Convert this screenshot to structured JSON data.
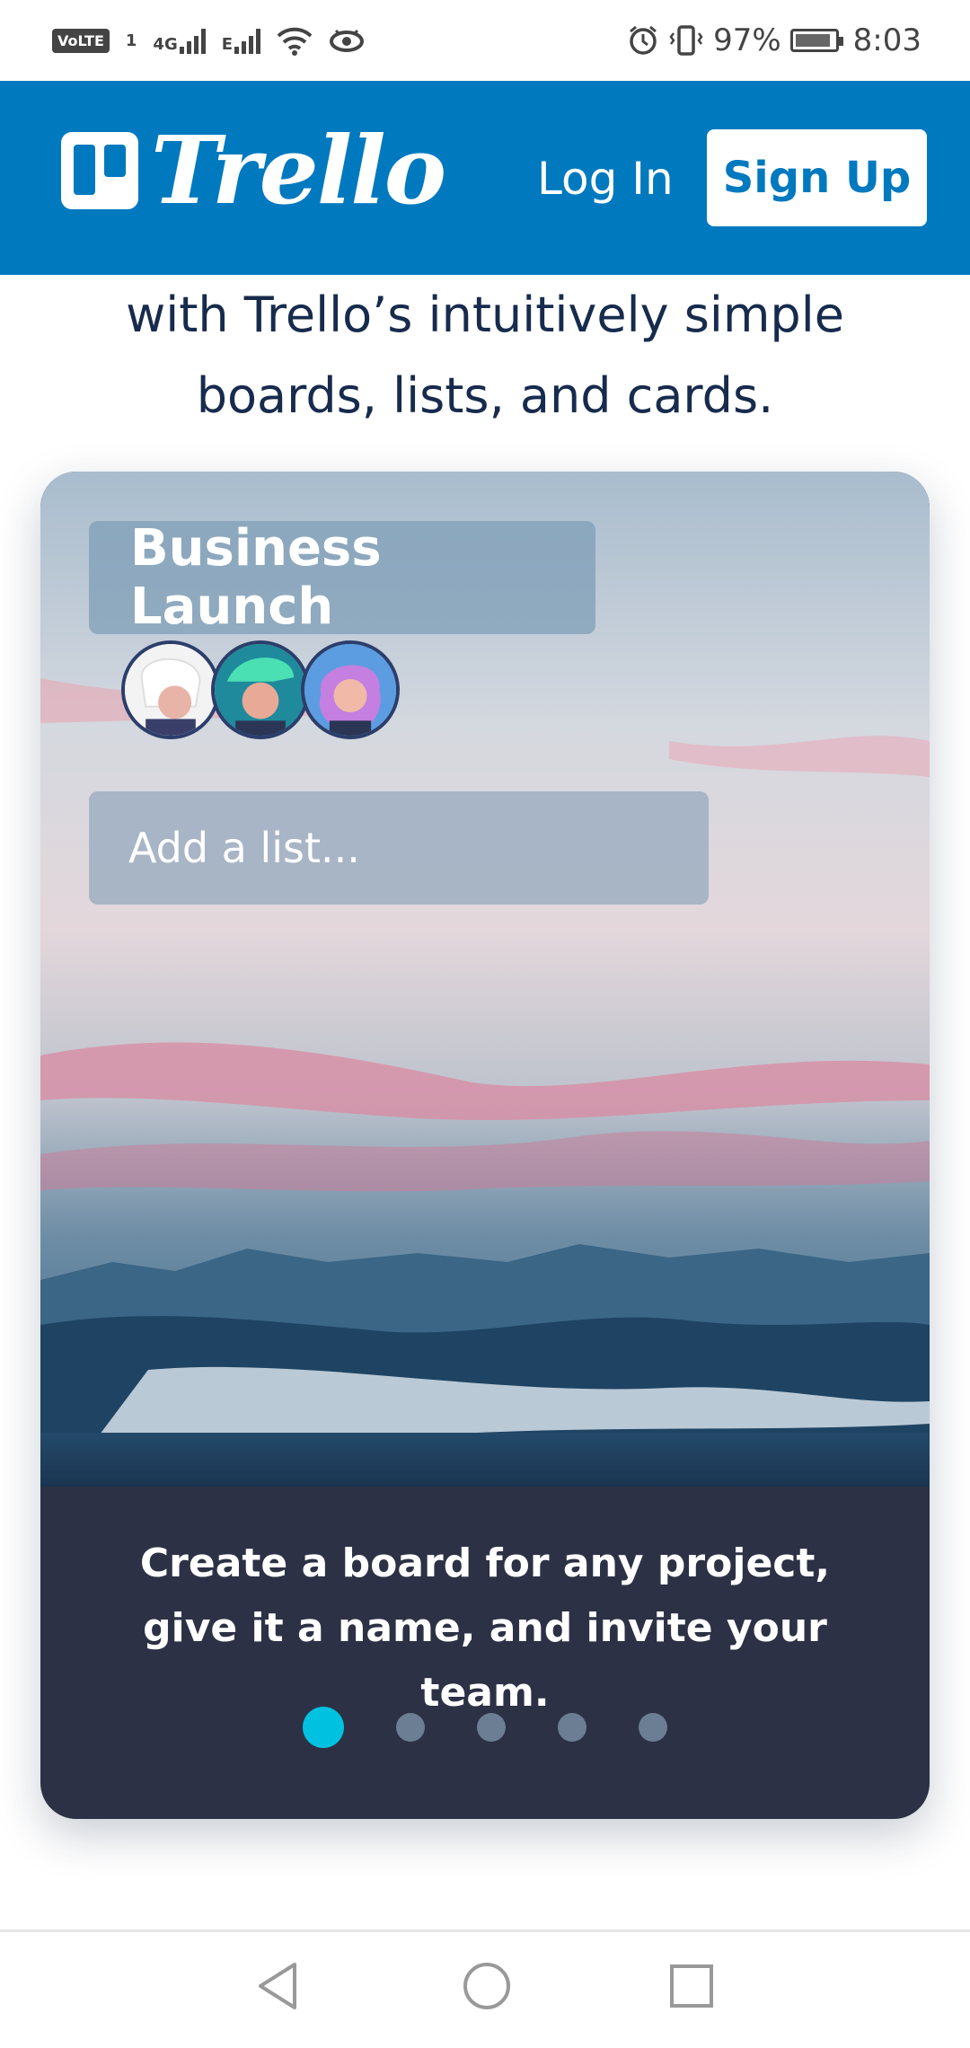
{
  "status_bar": {
    "volte": "VoLTE",
    "sim_badge": "1",
    "network1": "4G",
    "network2": "E",
    "battery_percent": "97%",
    "time": "8:03"
  },
  "header": {
    "brand": "Trello",
    "login_label": "Log In",
    "signup_label": "Sign Up",
    "colors": {
      "brand": "#0079bf"
    }
  },
  "intro": {
    "line1": "with Trello’s intuitively simple",
    "line2": "boards, lists, and cards."
  },
  "card": {
    "board_title": "Business Launch",
    "add_list_placeholder": "Add a list...",
    "caption": "Create a board for any project, give it a name, and invite your team.",
    "carousel": {
      "total": 5,
      "active_index": 0
    },
    "colors": {
      "active_dot": "#00c2e0",
      "caption_bg": "#2c3145"
    }
  },
  "icons": {
    "status": [
      "volte-icon",
      "signal-icon",
      "wifi-icon",
      "eye-icon",
      "alarm-icon",
      "vibrate-icon",
      "battery-icon"
    ],
    "nav": [
      "back-icon",
      "home-icon",
      "recents-icon"
    ]
  }
}
